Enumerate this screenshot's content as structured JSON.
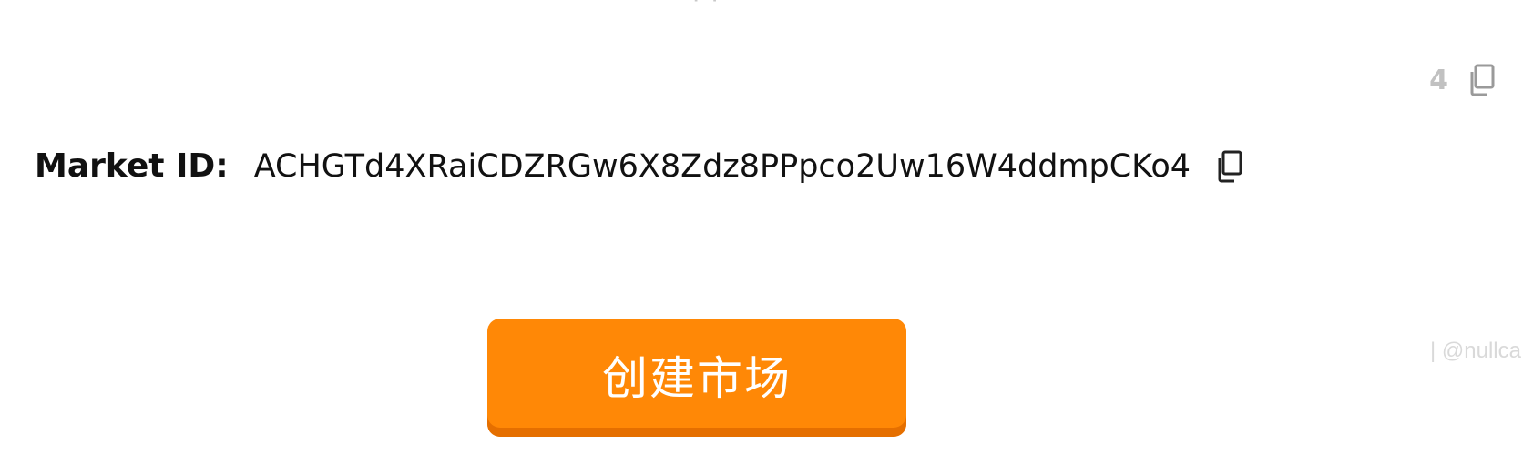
{
  "ghost_row": {
    "digit": "4",
    "copy_icon": "copy-icon"
  },
  "market": {
    "label": "Market ID:",
    "value": "ACHGTd4XRaiCDZRGw6X8Zdz8PPpco2Uw16W4ddmpCKo4",
    "copy_icon": "copy-icon"
  },
  "actions": {
    "create_market_label": "创建市场"
  },
  "watermark": {
    "text": "| @nullca"
  },
  "colors": {
    "button": "#ff8806",
    "button_shadow": "#e56f00",
    "text": "#111111"
  }
}
